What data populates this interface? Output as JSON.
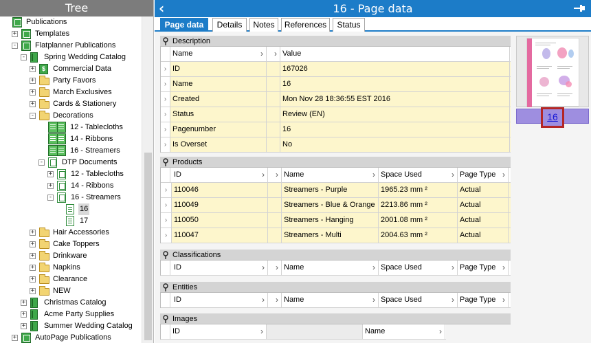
{
  "tree": {
    "header": "Tree",
    "items": [
      {
        "label": "Publications",
        "name": "tree-item-publications",
        "icon": "publications-icon",
        "exp": ""
      },
      {
        "label": "Templates",
        "name": "tree-item-templates",
        "icon": "publications-icon",
        "exp": "+"
      },
      {
        "label": "Flatplanner Publications",
        "name": "tree-item-flatplanner-publications",
        "icon": "publications-icon",
        "exp": "-"
      },
      {
        "label": "Spring Wedding Catalog",
        "name": "tree-item-spring-wedding-catalog",
        "icon": "catalog-icon",
        "exp": "-"
      },
      {
        "label": "Commercial Data",
        "name": "tree-item-commercial-data",
        "icon": "commercial-data-icon",
        "exp": "+"
      },
      {
        "label": "Party Favors",
        "name": "tree-item-party-favors",
        "icon": "folder-icon",
        "exp": "+"
      },
      {
        "label": "March Exclusives",
        "name": "tree-item-march-exclusives",
        "icon": "folder-icon",
        "exp": "+"
      },
      {
        "label": "Cards & Stationery",
        "name": "tree-item-cards-stationery",
        "icon": "folder-icon",
        "exp": "+"
      },
      {
        "label": "Decorations",
        "name": "tree-item-decorations",
        "icon": "folder-icon",
        "exp": "-"
      },
      {
        "label": "12 - Tablecloths",
        "name": "tree-item-12-tablecloths",
        "icon": "page-layout-icon",
        "exp": ""
      },
      {
        "label": "14 - Ribbons",
        "name": "tree-item-14-ribbons",
        "icon": "page-layout-icon",
        "exp": ""
      },
      {
        "label": "16 - Streamers",
        "name": "tree-item-16-streamers",
        "icon": "page-layout-icon",
        "exp": ""
      },
      {
        "label": "DTP Documents",
        "name": "tree-item-dtp-documents",
        "icon": "dtp-documents-icon",
        "exp": "-"
      },
      {
        "label": "12 - Tablecloths",
        "name": "tree-item-dtp-12-tablecloths",
        "icon": "dtp-document-icon",
        "exp": "+"
      },
      {
        "label": "14 - Ribbons",
        "name": "tree-item-dtp-14-ribbons",
        "icon": "dtp-document-icon",
        "exp": "+"
      },
      {
        "label": "16 - Streamers",
        "name": "tree-item-dtp-16-streamers",
        "icon": "dtp-document-icon",
        "exp": "-"
      },
      {
        "label": "16",
        "name": "tree-item-page-16",
        "icon": "page-icon",
        "exp": "",
        "selected": true
      },
      {
        "label": "17",
        "name": "tree-item-page-17",
        "icon": "page-icon",
        "exp": ""
      },
      {
        "label": "Hair Accessories",
        "name": "tree-item-hair-accessories",
        "icon": "folder-icon",
        "exp": "+"
      },
      {
        "label": "Cake Toppers",
        "name": "tree-item-cake-toppers",
        "icon": "folder-icon",
        "exp": "+"
      },
      {
        "label": "Drinkware",
        "name": "tree-item-drinkware",
        "icon": "folder-icon",
        "exp": "+"
      },
      {
        "label": "Napkins",
        "name": "tree-item-napkins",
        "icon": "folder-icon",
        "exp": "+"
      },
      {
        "label": "Clearance",
        "name": "tree-item-clearance",
        "icon": "folder-icon",
        "exp": "+"
      },
      {
        "label": "NEW",
        "name": "tree-item-new",
        "icon": "folder-icon",
        "exp": "+"
      },
      {
        "label": "Christmas Catalog",
        "name": "tree-item-christmas-catalog",
        "icon": "catalog-icon",
        "exp": "+"
      },
      {
        "label": "Acme Party Supplies",
        "name": "tree-item-acme-party-supplies",
        "icon": "catalog-icon",
        "exp": "+"
      },
      {
        "label": "Summer Wedding Catalog",
        "name": "tree-item-summer-wedding-catalog",
        "icon": "catalog-icon",
        "exp": "+"
      },
      {
        "label": "AutoPage Publications",
        "name": "tree-item-autopage-publications",
        "icon": "publications-icon",
        "exp": "+"
      }
    ]
  },
  "header": {
    "back_icon": "back-arrow-icon",
    "title": "16 - Page data",
    "pin_icon": "pin-icon"
  },
  "tabs": [
    {
      "label": "Page data",
      "active": true
    },
    {
      "label": "Details",
      "active": false
    },
    {
      "label": "Notes",
      "active": false
    },
    {
      "label": "References",
      "active": false
    },
    {
      "label": "Status",
      "active": false
    }
  ],
  "description": {
    "title": "Description",
    "columns": [
      "Name",
      "Value"
    ],
    "rows": [
      {
        "name": "ID",
        "value": "167026"
      },
      {
        "name": "Name",
        "value": "16"
      },
      {
        "name": "Created",
        "value": "Mon Nov 28 18:36:55 EST 2016"
      },
      {
        "name": "Status",
        "value": "Review (EN)"
      },
      {
        "name": "Pagenumber",
        "value": "16"
      },
      {
        "name": "Is Overset",
        "value": "No"
      }
    ]
  },
  "products": {
    "title": "Products",
    "columns": [
      "ID",
      "Name",
      "Space Used",
      "Page Type"
    ],
    "rows": [
      [
        "110046",
        "Streamers - Purple",
        "1965.23 mm ²",
        "Actual"
      ],
      [
        "110049",
        "Streamers - Blue & Orange",
        "2213.86 mm ²",
        "Actual"
      ],
      [
        "110050",
        "Streamers - Hanging",
        "2001.08 mm ²",
        "Actual"
      ],
      [
        "110047",
        "Streamers - Multi",
        "2004.63 mm ²",
        "Actual"
      ]
    ]
  },
  "classifications": {
    "title": "Classifications",
    "columns": [
      "ID",
      "Name",
      "Space Used",
      "Page Type"
    ]
  },
  "entities": {
    "title": "Entities",
    "columns": [
      "ID",
      "Name",
      "Space Used",
      "Page Type"
    ]
  },
  "images": {
    "title": "Images",
    "columns": [
      "ID",
      "Name"
    ]
  },
  "preview": {
    "page_number": "16"
  },
  "colors": {
    "accent": "#1c7cc8",
    "row_highlight": "#fdf6cc",
    "page_bar": "#9e8ee0",
    "callout_border": "#b42626"
  }
}
